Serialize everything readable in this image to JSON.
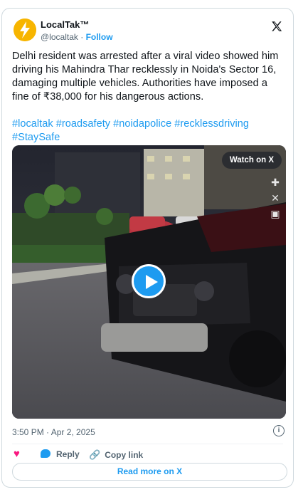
{
  "author": {
    "name": "LocalTak™",
    "handle": "@localtak",
    "separator": "·",
    "follow_label": "Follow"
  },
  "tweet": {
    "text": "Delhi resident was arrested after a viral video showed him driving his Mahindra Thar recklessly in Noida's Sector 16, damaging multiple vehicles. Authorities have imposed a fine of ₹38,000 for his dangerous actions.",
    "hashtags": "#localtak #roadsafety #noidapolice #recklessdriving #StaySafe"
  },
  "media": {
    "watch_label": "Watch on X"
  },
  "meta": {
    "timestamp": "3:50 PM · Apr 2, 2025"
  },
  "actions": {
    "reply_label": "Reply",
    "copy_link_label": "Copy link"
  },
  "footer": {
    "read_more_label": "Read more on X"
  },
  "colors": {
    "accent": "#1d9bf0",
    "like": "#f91880",
    "muted": "#536471"
  }
}
